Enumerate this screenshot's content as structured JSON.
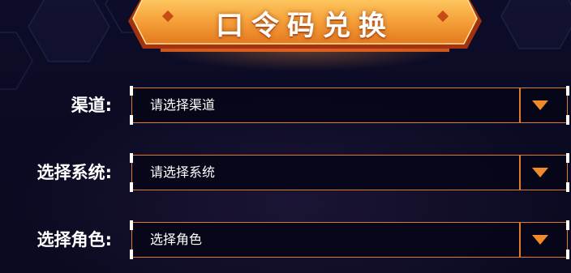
{
  "header": {
    "title": "口令码兑换"
  },
  "form": {
    "rows": [
      {
        "label": "渠道:",
        "placeholder": "请选择渠道",
        "icon": "chevron-down-icon"
      },
      {
        "label": "选择系统:",
        "placeholder": "请选择系统",
        "icon": "chevron-down-icon"
      },
      {
        "label": "选择角色:",
        "placeholder": "选择角色",
        "icon": "chevron-down-icon"
      }
    ]
  },
  "colors": {
    "background": "#0b0b24",
    "accent": "#e07a2c",
    "banner": "#f5a43a",
    "text": "#ffffff"
  }
}
